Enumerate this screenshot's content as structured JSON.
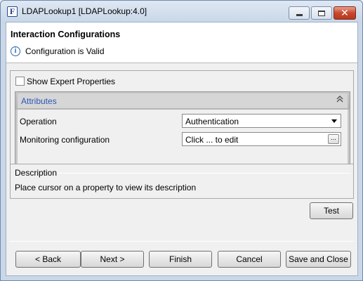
{
  "window": {
    "title": "LDAPLookup1 [LDAPLookup:4.0]",
    "icon_letter": "F",
    "controls": {
      "minimize": "minimize-icon",
      "maximize": "maximize-icon",
      "close": "✕"
    }
  },
  "header": {
    "title": "Interaction Configurations",
    "status_icon": "i",
    "status_text": "Configuration is Valid"
  },
  "properties": {
    "show_expert_label": "Show Expert Properties",
    "show_expert_checked": false,
    "attributes_section": {
      "title": "Attributes",
      "collapse_icon": "«",
      "rows": [
        {
          "label": "Operation",
          "value": "Authentication",
          "control": "dropdown"
        },
        {
          "label": "Monitoring configuration",
          "value": "Click ... to edit",
          "control": "ellipsis",
          "button_label": "..."
        }
      ]
    }
  },
  "description": {
    "title": "Description",
    "text": "Place cursor on a property to view its description"
  },
  "buttons": {
    "test": "Test",
    "back": "< Back",
    "next": "Next >",
    "finish": "Finish",
    "cancel": "Cancel",
    "save_close": "Save and Close"
  },
  "colors": {
    "accent_link": "#2a55b8",
    "close_button": "#c8482c"
  }
}
